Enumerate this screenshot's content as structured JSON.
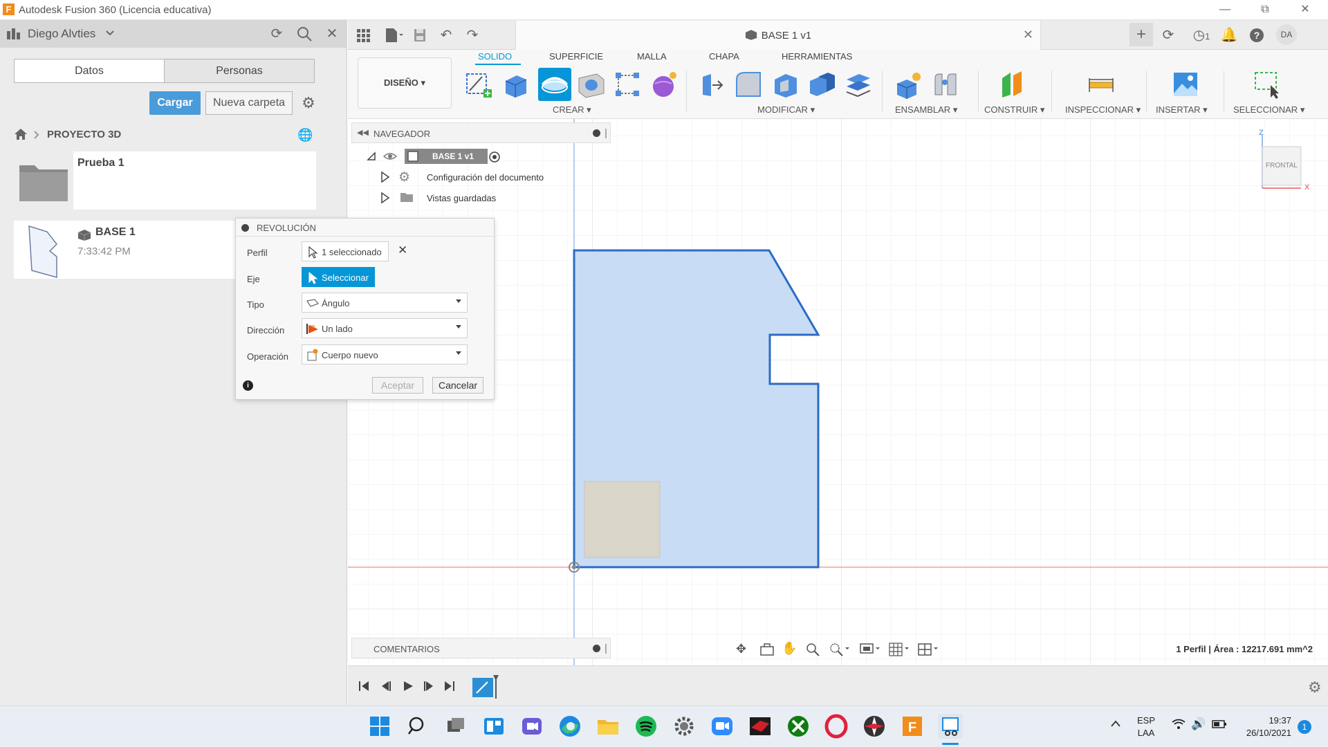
{
  "window": {
    "title": "Autodesk Fusion 360 (Licencia educativa)"
  },
  "data_panel": {
    "user": "Diego Alvties",
    "tabs": [
      "Datos",
      "Personas"
    ],
    "upload_label": "Cargar",
    "new_folder_label": "Nueva carpeta",
    "breadcrumb": "PROYECTO 3D",
    "items": [
      {
        "name": "Prueba 1",
        "meta": ""
      },
      {
        "name": "BASE 1",
        "meta": "7:33:42 PM"
      }
    ]
  },
  "document": {
    "tab_title": "BASE 1 v1",
    "jobs_count": "1",
    "user_initials": "DA"
  },
  "ribbon": {
    "workspace": "DISEÑO",
    "tabs": [
      "SOLIDO",
      "SUPERFICIE",
      "MALLA",
      "CHAPA",
      "HERRAMIENTAS"
    ],
    "active_tab": "SOLIDO",
    "groups": [
      "CREAR",
      "MODIFICAR",
      "ENSAMBLAR",
      "CONSTRUIR",
      "INSPECCIONAR",
      "INSERTAR",
      "SELECCIONAR"
    ]
  },
  "navigator": {
    "title": "NAVEGADOR",
    "root": "BASE 1 v1",
    "items": [
      "Configuración del documento",
      "Vistas guardadas"
    ]
  },
  "revolve_dialog": {
    "title": "REVOLUCIÓN",
    "rows": {
      "profile_label": "Perfil",
      "profile_value": "1 seleccionado",
      "axis_label": "Eje",
      "axis_value": "Seleccionar",
      "type_label": "Tipo",
      "type_value": "Ángulo",
      "direction_label": "Dirección",
      "direction_value": "Un lado",
      "operation_label": "Operación",
      "operation_value": "Cuerpo nuevo"
    },
    "ok_label": "Aceptar",
    "cancel_label": "Cancelar"
  },
  "viewcube": {
    "face": "FRONTAL",
    "z_label": "Z",
    "x_label": "X"
  },
  "comments": {
    "title": "COMENTARIOS"
  },
  "status": {
    "selection_info": "1 Perfil | Área : 12217.691 mm^2"
  },
  "taskbar": {
    "lang_line1": "ESP",
    "lang_line2": "LAA",
    "time": "19:37",
    "date": "26/10/2021",
    "notification_count": "1"
  },
  "colors": {
    "accent": "#0696d7",
    "sketch_fill": "#c8dcf5",
    "sketch_stroke": "#2b6cc4",
    "x_axis": "#f0a0a0",
    "z_axis": "#9bbbe8"
  }
}
